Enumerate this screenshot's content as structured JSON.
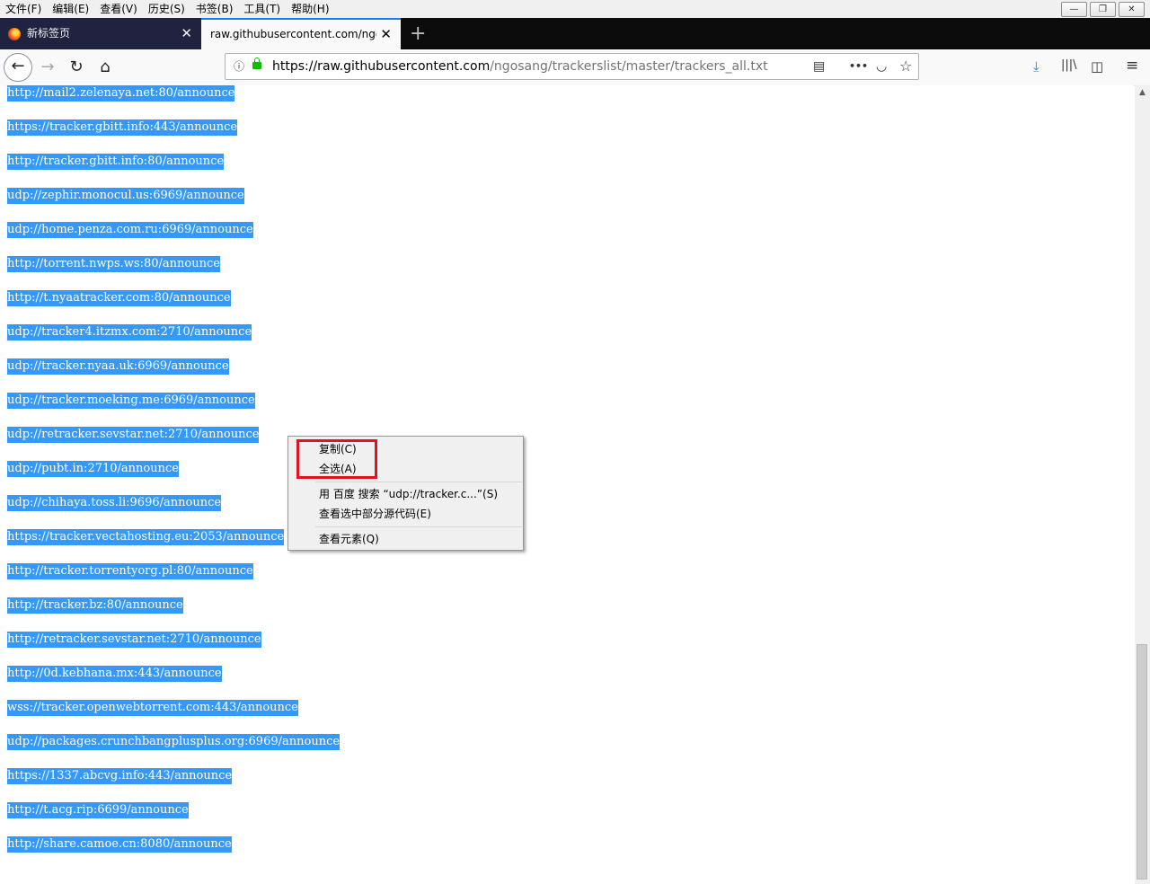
{
  "menubar": {
    "items": [
      "文件(F)",
      "编辑(E)",
      "查看(V)",
      "历史(S)",
      "书签(B)",
      "工具(T)",
      "帮助(H)"
    ]
  },
  "window_controls": {
    "minimize": "—",
    "restore": "❐",
    "close": "✕"
  },
  "tabs": [
    {
      "title": "新标签页",
      "close": "✕"
    },
    {
      "title": "raw.githubusercontent.com/ngos",
      "close": "✕"
    }
  ],
  "new_tab_symbol": "+",
  "nav": {
    "back": "←",
    "forward": "→",
    "reload": "↻",
    "home": "⌂",
    "url_host": "https://raw.githubusercontent.com",
    "url_path": "/ngosang/trackerslist/master/trackers_all.txt",
    "info": "ⓘ",
    "reader": "▤",
    "more": "•••",
    "pocket": "◡",
    "star": "☆",
    "download": "⤓",
    "library": "|||\\",
    "sidebar": "◫",
    "menu": "≡"
  },
  "content": {
    "lines": [
      "http://mail2.zelenaya.net:80/announce",
      "https://tracker.gbitt.info:443/announce",
      "http://tracker.gbitt.info:80/announce",
      "udp://zephir.monocul.us:6969/announce",
      "udp://home.penza.com.ru:6969/announce",
      "http://torrent.nwps.ws:80/announce",
      "http://t.nyaatracker.com:80/announce",
      "udp://tracker4.itzmx.com:2710/announce",
      "udp://tracker.nyaa.uk:6969/announce",
      "udp://tracker.moeking.me:6969/announce",
      "udp://retracker.sevstar.net:2710/announce",
      "udp://pubt.in:2710/announce",
      "udp://chihaya.toss.li:9696/announce",
      "https://tracker.vectahosting.eu:2053/announce",
      "http://tracker.torrentyorg.pl:80/announce",
      "http://tracker.bz:80/announce",
      "http://retracker.sevstar.net:2710/announce",
      "http://0d.kebhana.mx:443/announce",
      "wss://tracker.openwebtorrent.com:443/announce",
      "udp://packages.crunchbangplusplus.org:6969/announce",
      "https://1337.abcvg.info:443/announce",
      "http://t.acg.rip:6699/announce",
      "http://share.camoe.cn:8080/announce"
    ]
  },
  "context_menu": {
    "copy": "复制(C)",
    "select_all": "全选(A)",
    "search": "用 百度 搜索 “udp://tracker.c...”(S)",
    "view_selection_source": "查看选中部分源代码(E)",
    "inspect": "查看元素(Q)"
  },
  "scrollbar": {
    "up_arrow": "▲"
  },
  "colors": {
    "selection": "#3399ff",
    "highlight_box": "#e0141e",
    "tab_accent": "#0a84ff"
  }
}
